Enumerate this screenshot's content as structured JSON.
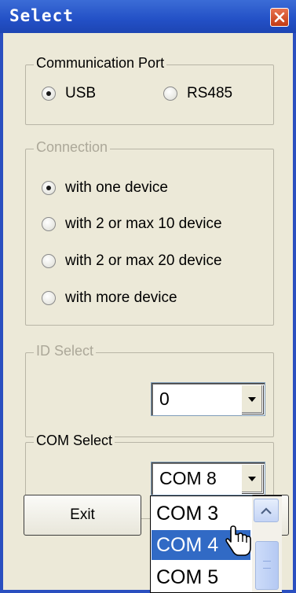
{
  "window": {
    "title": "Select"
  },
  "communication_port": {
    "label": "Communication Port",
    "options": [
      {
        "label": "USB",
        "checked": true
      },
      {
        "label": "RS485",
        "checked": false
      }
    ]
  },
  "connection": {
    "label": "Connection",
    "options": [
      {
        "label": "with one device",
        "checked": true
      },
      {
        "label": "with 2 or max 10 device",
        "checked": false
      },
      {
        "label": "with 2 or max 20 device",
        "checked": false
      },
      {
        "label": "with more device",
        "checked": false
      }
    ]
  },
  "id_select": {
    "label": "ID Select",
    "value": "0"
  },
  "com_select": {
    "label": "COM Select",
    "value": "COM 8",
    "dropdown_items": [
      "COM 3",
      "COM 4",
      "COM 5"
    ],
    "selected_item": "COM 4"
  },
  "buttons": {
    "exit_label": "Exit"
  },
  "colors": {
    "title_bar": "#2350c6",
    "selection": "#316ac5",
    "close_button": "#c23a13",
    "dialog_background": "#ece9d8"
  }
}
